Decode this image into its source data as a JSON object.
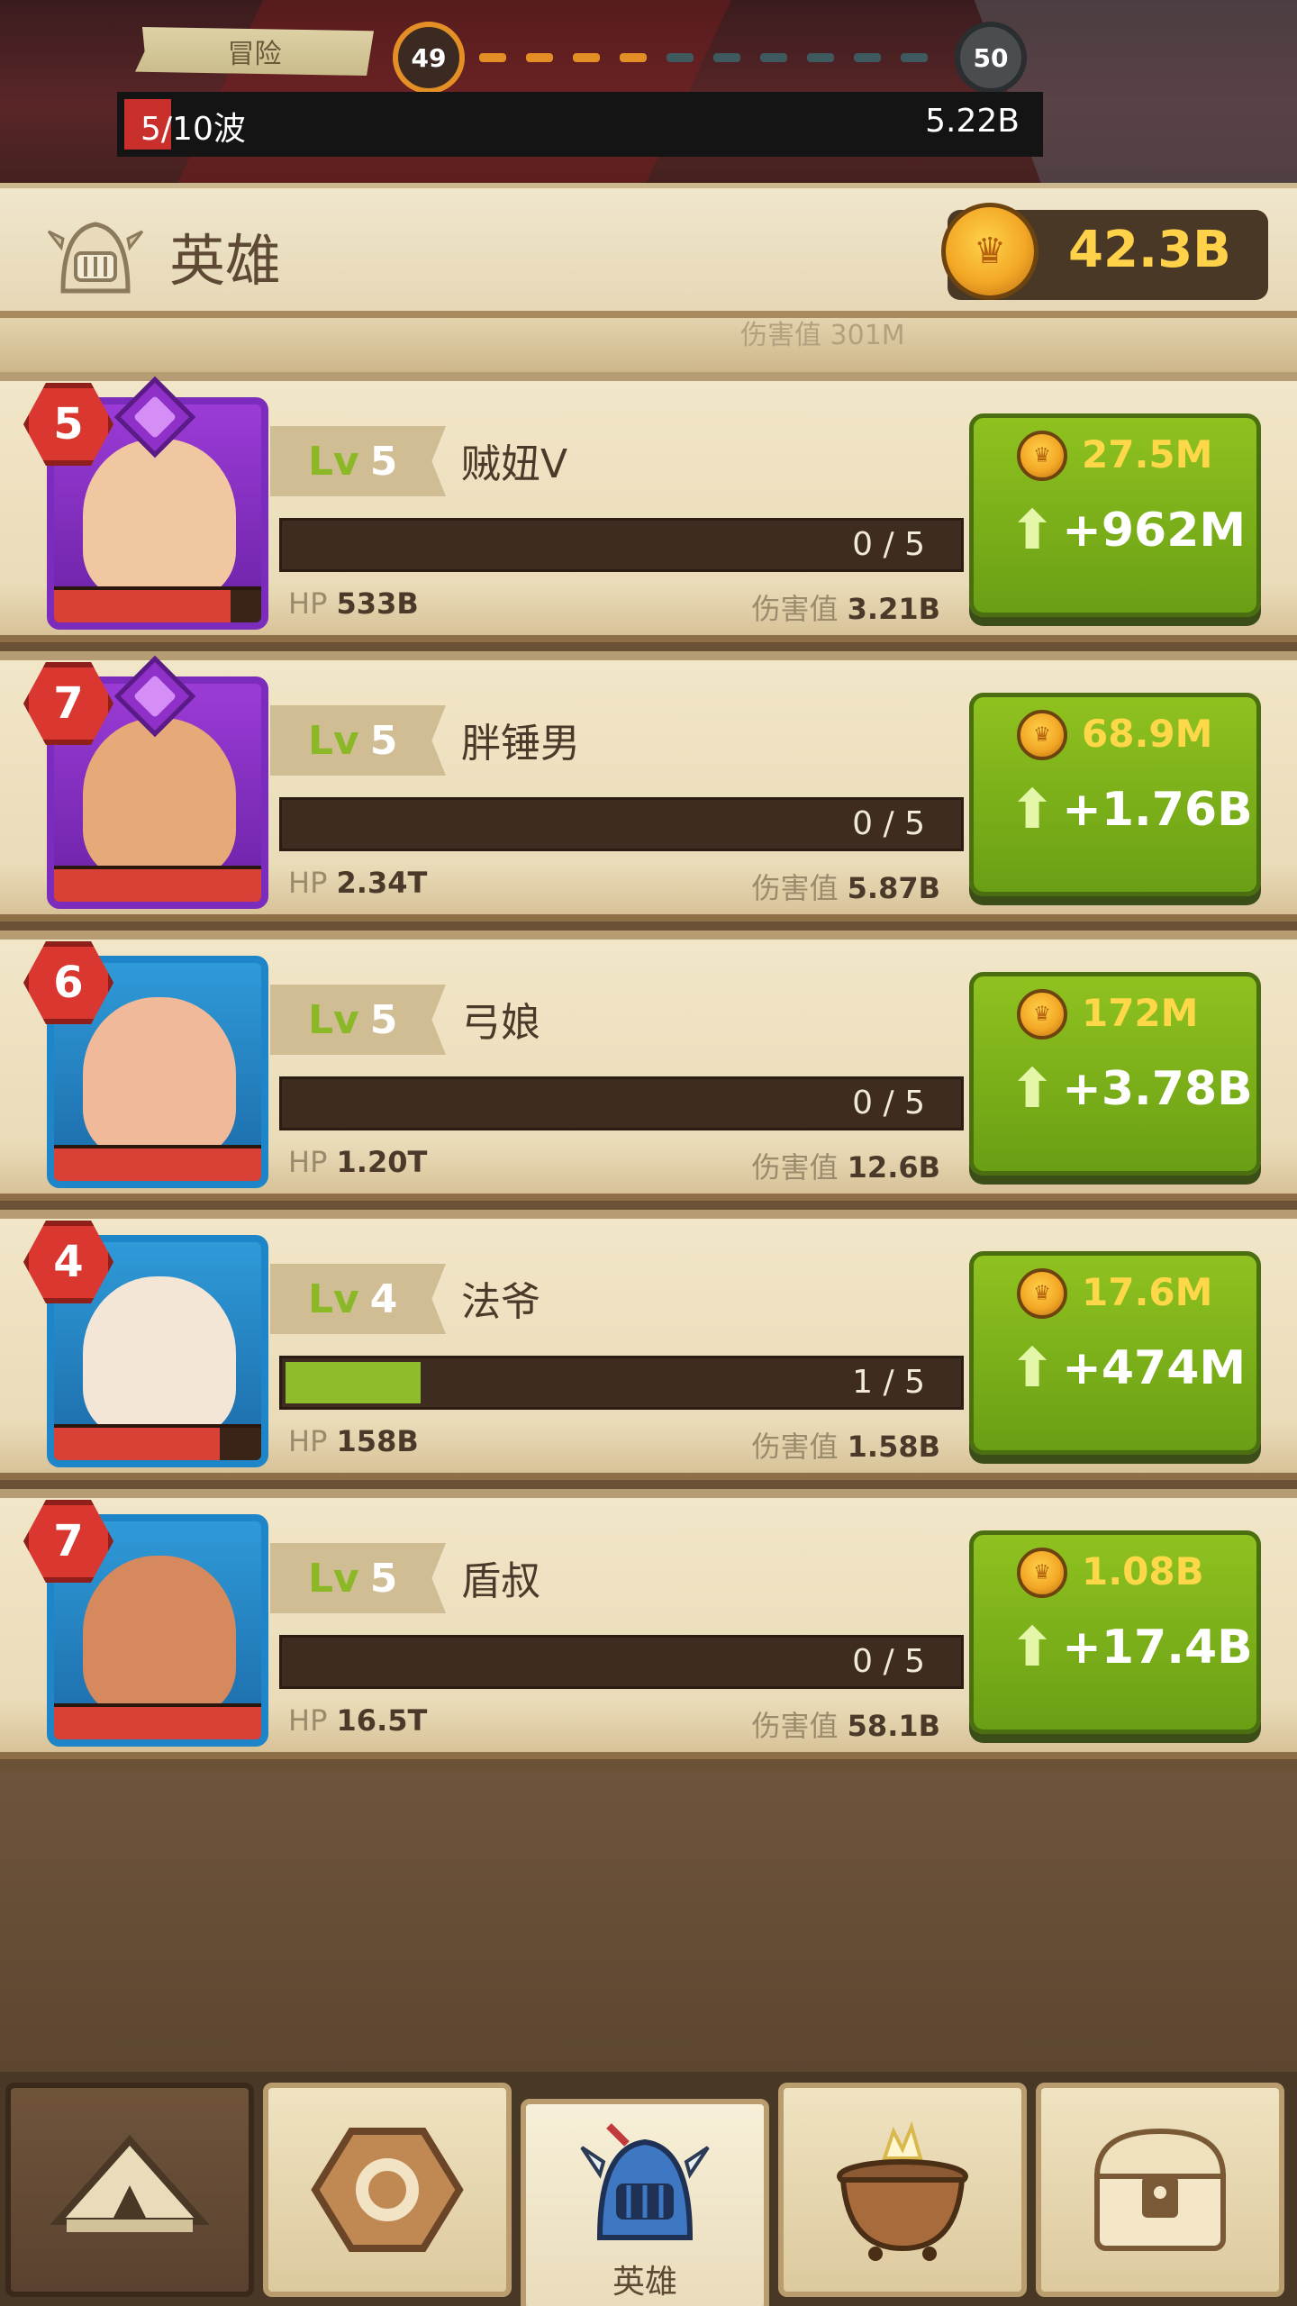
{
  "top": {
    "stage_label": "冒险",
    "current_stage": "49",
    "next_stage": "50",
    "wave_current": "5",
    "wave_text": "/10波",
    "wave_value": "5.22B"
  },
  "header": {
    "title": "英雄",
    "gold": "42.3B"
  },
  "peek_row": {
    "text": "伤害值 301M"
  },
  "heroes": [
    {
      "stars": "5",
      "lv_label": "Lv",
      "level": "5",
      "name": "贼妞V",
      "xp": "0 / 5",
      "xp_fraction": 0.0,
      "hp_label": "HP",
      "hp": "533B",
      "dmg_label": "伤害值",
      "dmg": "3.21B",
      "cost": "27.5M",
      "gain": "+962M",
      "frame": "purple",
      "health_fraction": 0.85,
      "face_color": "#f1c7a2"
    },
    {
      "stars": "7",
      "lv_label": "Lv",
      "level": "5",
      "name": "胖锤男",
      "xp": "0 / 5",
      "xp_fraction": 0.0,
      "hp_label": "HP",
      "hp": "2.34T",
      "dmg_label": "伤害值",
      "dmg": "5.87B",
      "cost": "68.9M",
      "gain": "+1.76B",
      "frame": "purple",
      "health_fraction": 1.0,
      "face_color": "#e7a977"
    },
    {
      "stars": "6",
      "lv_label": "Lv",
      "level": "5",
      "name": "弓娘",
      "xp": "0 / 5",
      "xp_fraction": 0.0,
      "hp_label": "HP",
      "hp": "1.20T",
      "dmg_label": "伤害值",
      "dmg": "12.6B",
      "cost": "172M",
      "gain": "+3.78B",
      "frame": "blue",
      "health_fraction": 1.0,
      "face_color": "#f0b99a"
    },
    {
      "stars": "4",
      "lv_label": "Lv",
      "level": "4",
      "name": "法爷",
      "xp": "1 / 5",
      "xp_fraction": 0.2,
      "hp_label": "HP",
      "hp": "158B",
      "dmg_label": "伤害值",
      "dmg": "1.58B",
      "cost": "17.6M",
      "gain": "+474M",
      "frame": "blue",
      "health_fraction": 0.8,
      "face_color": "#f3e6d6"
    },
    {
      "stars": "7",
      "lv_label": "Lv",
      "level": "5",
      "name": "盾叔",
      "xp": "0 / 5",
      "xp_fraction": 0.0,
      "hp_label": "HP",
      "hp": "16.5T",
      "dmg_label": "伤害值",
      "dmg": "58.1B",
      "cost": "1.08B",
      "gain": "+17.4B",
      "frame": "blue",
      "health_fraction": 1.0,
      "face_color": "#d6895c"
    }
  ],
  "tabs": [
    {
      "icon": "camp-tent-icon",
      "label": ""
    },
    {
      "icon": "rune-stone-icon",
      "label": ""
    },
    {
      "icon": "knight-helmet-icon",
      "label": "英雄"
    },
    {
      "icon": "cauldron-icon",
      "label": ""
    },
    {
      "icon": "treasure-chest-icon",
      "label": ""
    }
  ],
  "colors": {
    "accent_green": "#8fc21f",
    "gold": "#ffd24a",
    "stage_orange": "#e48f26",
    "badge_red": "#d9372f",
    "purple_frame": "#7b2cbd",
    "blue_frame": "#1e86c8"
  }
}
